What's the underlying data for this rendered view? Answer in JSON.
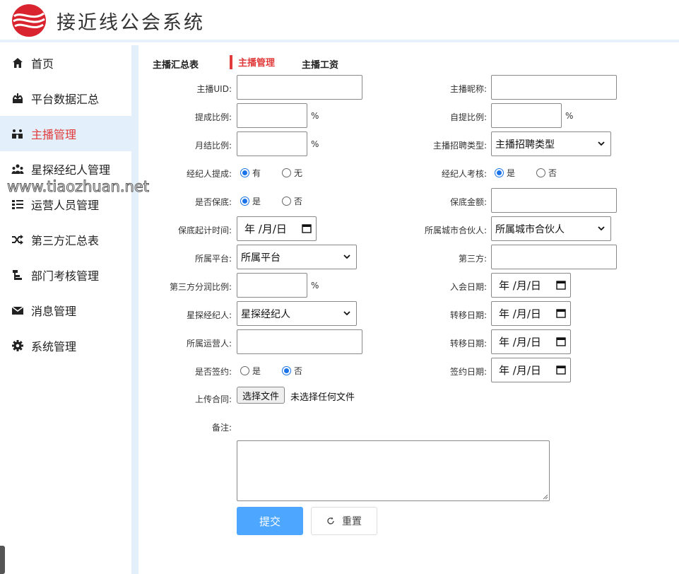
{
  "app": {
    "title": "接近线公会系统",
    "logo": "wave-logo",
    "accent": "#e13a3a",
    "sidebar_bg": "#e3effa",
    "button_blue": "#4da6ff"
  },
  "watermark": "www.tiaozhuan.net",
  "sidebar": {
    "items": [
      {
        "label": "首页",
        "icon": "home-icon",
        "active": false
      },
      {
        "label": "平台数据汇总",
        "icon": "inbox-download-icon",
        "active": false
      },
      {
        "label": "主播管理",
        "icon": "anchor-people-icon",
        "active": true
      },
      {
        "label": "星探经纪人管理",
        "icon": "group-icon",
        "active": false
      },
      {
        "label": "运营人员管理",
        "icon": "id-list-icon",
        "active": false
      },
      {
        "label": "第三方汇总表",
        "icon": "shuffle-icon",
        "active": false
      },
      {
        "label": "部门考核管理",
        "icon": "org-chart-icon",
        "active": false
      },
      {
        "label": "消息管理",
        "icon": "envelope-icon",
        "active": false
      },
      {
        "label": "系统管理",
        "icon": "gear-icon",
        "active": false
      }
    ]
  },
  "tabs": [
    {
      "label": "主播汇总表",
      "active": false
    },
    {
      "label": "主播管理",
      "active": true
    },
    {
      "label": "主播工资",
      "active": false
    }
  ],
  "form": {
    "anchor_uid_label": "主播UID:",
    "anchor_nick_label": "主播昵称:",
    "commission_label": "提成比例:",
    "self_commission_label": "自提比例:",
    "monthly_label": "月结比例:",
    "recruit_type_label": "主播招聘类型:",
    "recruit_type_value": "主播招聘类型",
    "agent_commission_label": "经纪人提成:",
    "agent_commission_options": [
      "有",
      "无"
    ],
    "agent_commission_selected": "有",
    "agent_review_label": "经纪人考核:",
    "agent_review_options": [
      "是",
      "否"
    ],
    "agent_review_selected": "是",
    "guarantee_label": "是否保底:",
    "guarantee_options": [
      "是",
      "否"
    ],
    "guarantee_selected": "是",
    "guarantee_amount_label": "保底金额:",
    "guarantee_start_label": "保底起计时间:",
    "city_partner_label": "所属城市合伙人:",
    "city_partner_value": "所属城市合伙人",
    "platform_label": "所属平台:",
    "platform_value": "所属平台",
    "third_party_label": "第三方:",
    "third_share_label": "第三方分润比例:",
    "join_date_label": "入会日期:",
    "scout_agent_label": "星探经纪人:",
    "scout_agent_value": "星探经纪人",
    "transfer_date_label": "转移日期:",
    "operator_label": "所属运营人:",
    "transfer_date_label2": "转移日期:",
    "signed_label": "是否签约:",
    "signed_options": [
      "是",
      "否"
    ],
    "signed_selected": "否",
    "sign_date_label": "签约日期:",
    "upload_label": "上传合同:",
    "upload_button": "选择文件",
    "upload_status": "未选择任何文件",
    "remark_label": "备注:",
    "percent": "%",
    "date_placeholder": "年 /月/日",
    "submit": "提交",
    "reset": "重置"
  }
}
